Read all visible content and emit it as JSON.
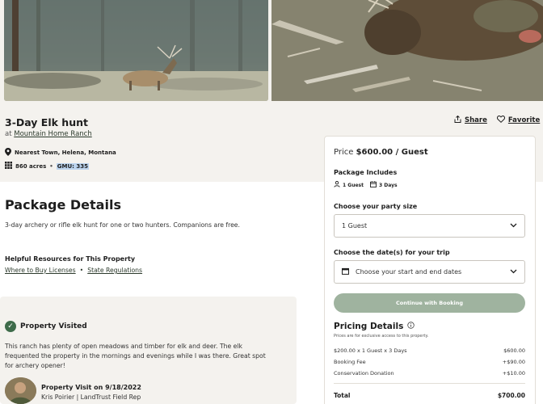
{
  "listing": {
    "title": "3-Day Elk hunt",
    "at_prefix": "at",
    "ranch": "Mountain Home Ranch",
    "town": "Nearest Town, Helena, Montana",
    "acres": "860 acres",
    "separator": "•",
    "gmu": "GMU: 335"
  },
  "actions": {
    "share": "Share",
    "favorite": "Favorite"
  },
  "package": {
    "section_title": "Package Details",
    "description": "3-day archery or rifle elk hunt for one or two hunters. Companions are free.",
    "resources_title": "Helpful Resources for This Property",
    "resources": [
      "Where to Buy Licenses",
      "State Regulations"
    ],
    "resource_separator": "•"
  },
  "visit": {
    "heading": "Property Visited",
    "text": "This ranch has plenty of open meadows and timber for elk and deer. The elk frequented the property in the mornings and evenings while I was there. Great spot for archery opener!",
    "visit_title": "Property Visit on 9/18/2022",
    "visitor": "Kris Poirier | LandTrust Field Rep"
  },
  "booking": {
    "price_prefix": "Price",
    "price": "$600.00 / Guest",
    "includes_title": "Package Includes",
    "includes": [
      {
        "icon": "person-icon",
        "label": "1 Guest"
      },
      {
        "icon": "calendar-icon",
        "label": "3 Days"
      }
    ],
    "party_label": "Choose your party size",
    "party_value": "1 Guest",
    "dates_label": "Choose the date(s) for your trip",
    "dates_placeholder": "Choose your start and end dates",
    "continue_button": "Continue with Booking",
    "pricing_title": "Pricing Details",
    "pricing_note": "Prices are for exclusive access to this property.",
    "rows": [
      {
        "label": "$200.00 x 1 Guest x 3 Days",
        "value": "$600.00"
      },
      {
        "label": "Booking Fee",
        "value": "+$90.00"
      },
      {
        "label": "Conservation Donation",
        "value": "+$10.00"
      }
    ],
    "total_label": "Total",
    "total_value": "$700.00"
  },
  "colors": {
    "page_bg": "#f4f2ee",
    "brand_green": "#3e6b4a",
    "button_disabled": "#9fb39f",
    "gmu_highlight": "#bcd4ee"
  }
}
